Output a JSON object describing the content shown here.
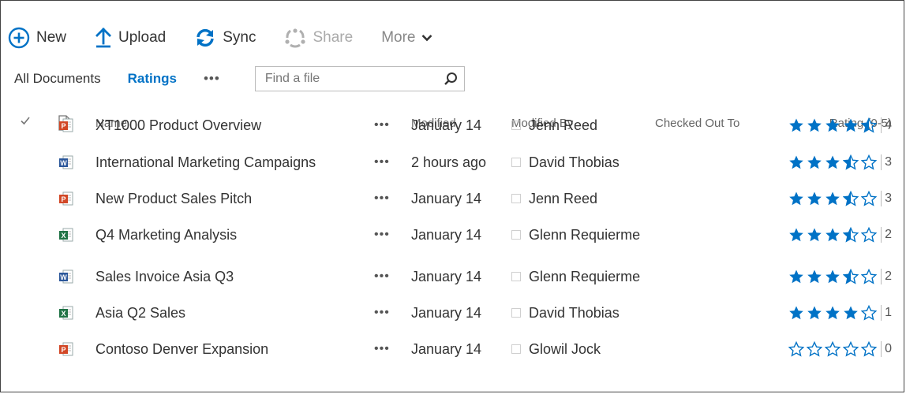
{
  "toolbar": {
    "new_label": "New",
    "upload_label": "Upload",
    "sync_label": "Sync",
    "share_label": "Share",
    "more_label": "More"
  },
  "views": {
    "all_documents": "All Documents",
    "ratings": "Ratings",
    "ellipsis": "•••",
    "search_placeholder": "Find a file"
  },
  "columns": {
    "name": "Name",
    "modified": "Modified",
    "modified_by": "Modified By",
    "checked_out_to": "Checked Out To",
    "rating": "Rating (0-5)"
  },
  "colors": {
    "accent": "#0072c6",
    "ppt": "#d24726",
    "word": "#2b579a",
    "excel": "#217346"
  },
  "files": [
    {
      "name": "XT1000 Product Overview",
      "type": "ppt",
      "modified": "January 14",
      "modified_by": "Jenn Reed",
      "rating": 4.5,
      "rating_label": "4"
    },
    {
      "name": "International Marketing Campaigns",
      "type": "word",
      "modified": "2 hours ago",
      "modified_by": "David Thobias",
      "rating": 3.5,
      "rating_label": "3"
    },
    {
      "name": "New Product Sales Pitch",
      "type": "ppt",
      "modified": "January 14",
      "modified_by": "Jenn Reed",
      "rating": 3.5,
      "rating_label": "3"
    },
    {
      "name": "Q4 Marketing Analysis",
      "type": "excel",
      "modified": "January 14",
      "modified_by": "Glenn Requierme",
      "rating": 3.5,
      "rating_label": "2"
    },
    {
      "name": "Sales Invoice Asia Q3",
      "type": "word",
      "modified": "January 14",
      "modified_by": "Glenn Requierme",
      "rating": 3.5,
      "rating_label": "2"
    },
    {
      "name": "Asia Q2 Sales",
      "type": "excel",
      "modified": "January 14",
      "modified_by": "David Thobias",
      "rating": 4,
      "rating_label": "1"
    },
    {
      "name": "Contoso Denver Expansion",
      "type": "ppt",
      "modified": "January 14",
      "modified_by": "Glowil Jock",
      "rating": 0,
      "rating_label": "0"
    }
  ]
}
